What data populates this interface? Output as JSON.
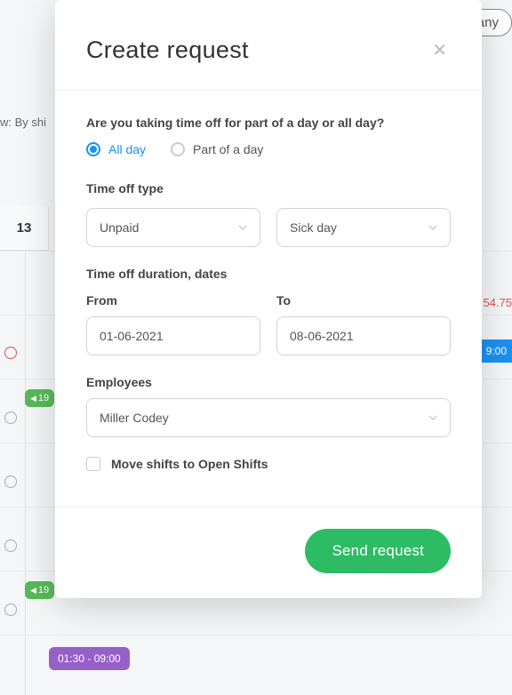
{
  "background": {
    "company_label": "Company",
    "filter_label": "w: By shi",
    "day_number": "13",
    "red_value": "54.75",
    "blue_chip": "9:00",
    "green_chip_1": "19",
    "green_chip_2": "19",
    "purple_chip": "01:30 - 09:00"
  },
  "modal": {
    "title": "Create request",
    "question": "Are you taking time off for part of a day or all day?",
    "radio_all_day": "All day",
    "radio_part_day": "Part of a day",
    "type_label": "Time off type",
    "type_value_1": "Unpaid",
    "type_value_2": "Sick day",
    "duration_label": "Time off duration, dates",
    "from_label": "From",
    "from_value": "01-06-2021",
    "to_label": "To",
    "to_value": "08-06-2021",
    "employees_label": "Employees",
    "employee_value": "Miller Codey",
    "move_shifts_label": "Move shifts to Open Shifts",
    "send_button": "Send request"
  }
}
